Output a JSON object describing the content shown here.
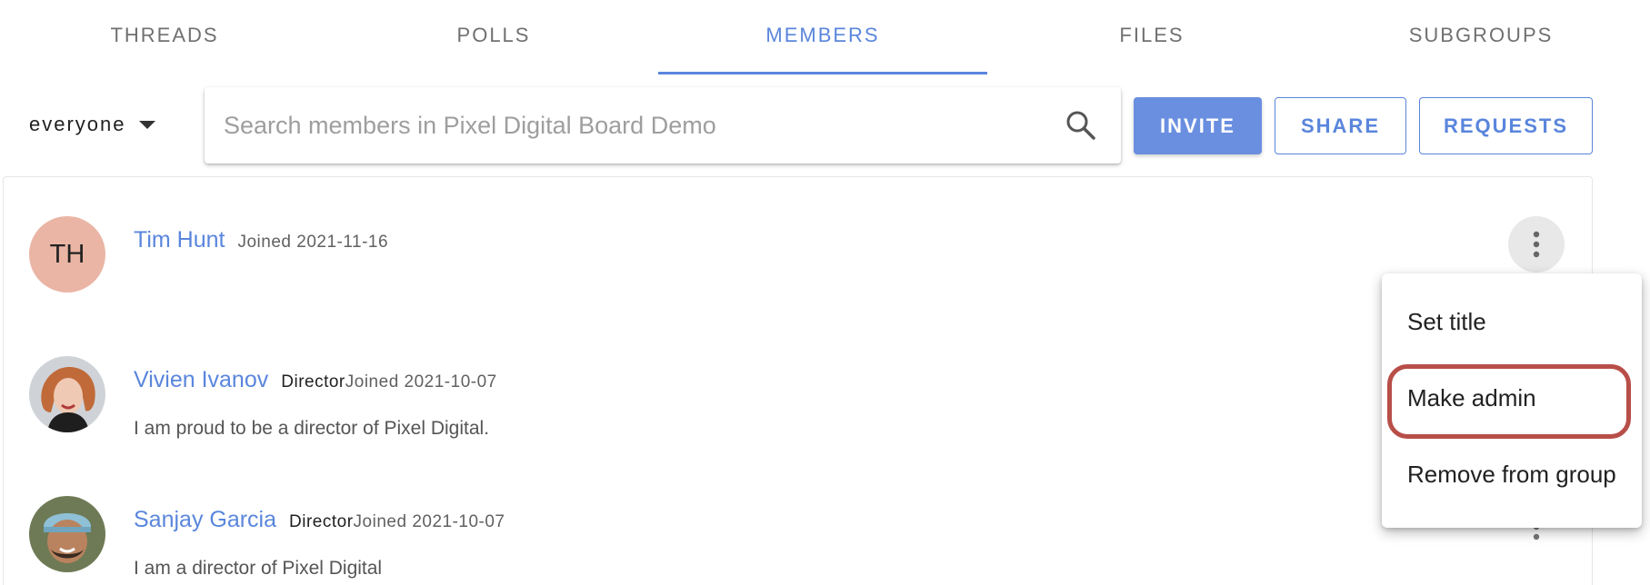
{
  "tabs": [
    {
      "label": "THREADS",
      "active": false
    },
    {
      "label": "POLLS",
      "active": false
    },
    {
      "label": "MEMBERS",
      "active": true
    },
    {
      "label": "FILES",
      "active": false
    },
    {
      "label": "SUBGROUPS",
      "active": false
    }
  ],
  "filter": {
    "label": "everyone",
    "icon": "caret-down-icon"
  },
  "search": {
    "placeholder": "Search members in Pixel Digital Board Demo",
    "value": "",
    "icon": "search-icon"
  },
  "actions": {
    "invite_label": "INVITE",
    "share_label": "SHARE",
    "requests_label": "REQUESTS"
  },
  "members": [
    {
      "initials": "TH",
      "name": "Tim Hunt",
      "title": "",
      "joined": "Joined 2021-11-16",
      "bio": ""
    },
    {
      "initials": "",
      "name": "Vivien Ivanov",
      "title": "Director",
      "joined": "Joined 2021-10-07",
      "bio": "I am proud to be a director of Pixel Digital."
    },
    {
      "initials": "",
      "name": "Sanjay Garcia",
      "title": "Director",
      "joined": "Joined 2021-10-07",
      "bio": "I am a director of Pixel Digital"
    }
  ],
  "menu": {
    "items": [
      "Set title",
      "Make admin",
      "Remove from group"
    ],
    "highlighted": "Make admin"
  },
  "colors": {
    "accent": "#5a86dc",
    "invite_bg": "#6a8fe0",
    "avatar_initials_bg": "#eab5a5",
    "highlight_ring": "#b84e48"
  }
}
